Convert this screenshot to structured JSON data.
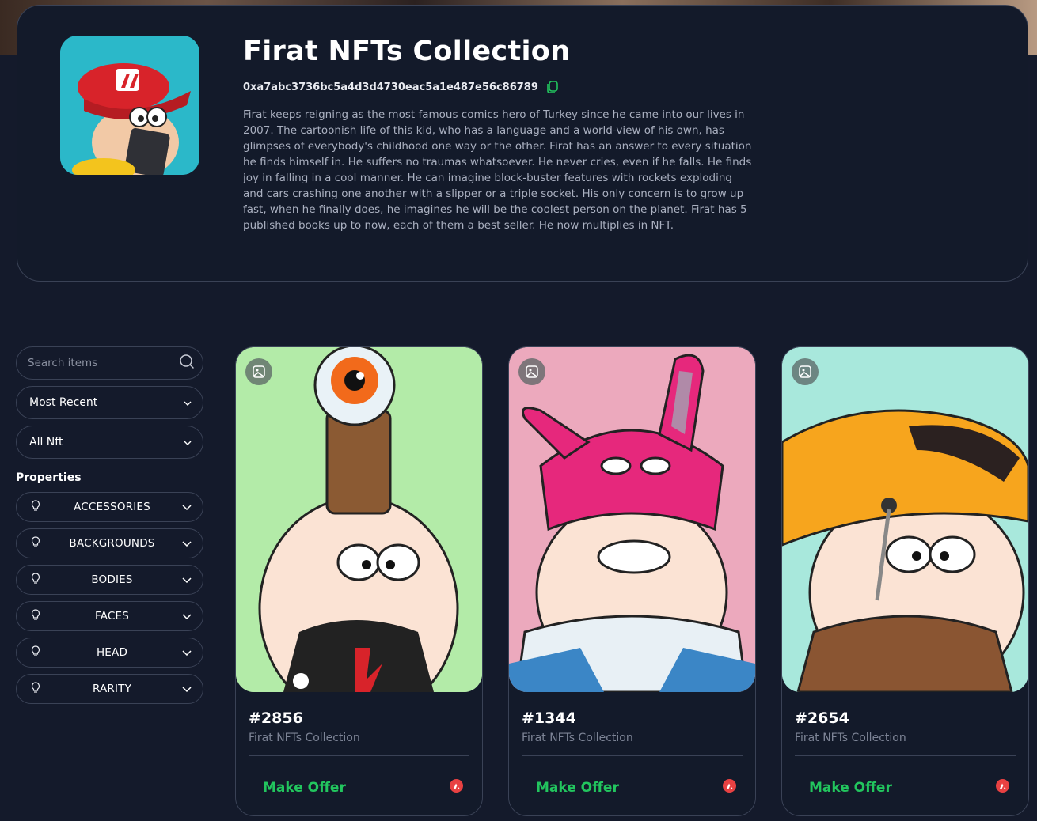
{
  "header": {
    "title": "Firat NFTs Collection",
    "address": "0xa7abc3736bc5a4d3d4730eac5a1e487e56c86789",
    "description": "Firat keeps reigning as the most famous comics hero of Turkey since he came into our lives in 2007. The cartoonish life of this kid, who has a language and a world-view of his own, has glimpses of everybody's childhood one way or the other. Firat has an answer to every situation he finds himself in. He suffers no traumas whatsoever. He never cries, even if he falls. He finds joy in falling in a cool manner. He can imagine block-buster features with rockets exploding and cars crashing one another with a slipper or a triple socket. His only concern is to grow up fast, when he finally does, he imagines he will be the coolest person on the planet. Firat has 5 published books up to now, each of them a best seller. He now multiplies in NFT."
  },
  "sidebar": {
    "search_placeholder": "Search items",
    "sort_value": "Most Recent",
    "filter_value": "All Nft",
    "properties_title": "Properties",
    "properties": [
      {
        "label": "ACCESSORIES"
      },
      {
        "label": "BACKGROUNDS"
      },
      {
        "label": "BODIES"
      },
      {
        "label": "FACES"
      },
      {
        "label": "HEAD"
      },
      {
        "label": "RARITY"
      }
    ]
  },
  "cards": [
    {
      "id": "#2856",
      "collection": "Firat NFTs Collection",
      "action": "Make Offer",
      "bg": "#b3eba8"
    },
    {
      "id": "#1344",
      "collection": "Firat NFTs Collection",
      "action": "Make Offer",
      "bg": "#eca9bd"
    },
    {
      "id": "#2654",
      "collection": "Firat NFTs Collection",
      "action": "Make Offer",
      "bg": "#a8e8dc"
    }
  ],
  "colors": {
    "background": "#141a2b",
    "border": "#3a4256",
    "accent_green": "#22c55e",
    "chain_red": "#e84142"
  }
}
